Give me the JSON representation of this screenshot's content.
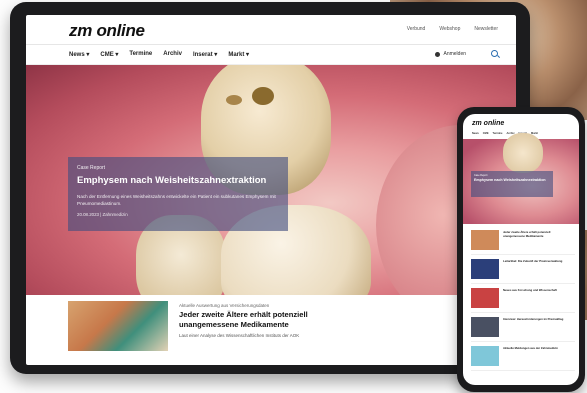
{
  "site": {
    "logo": "zm online",
    "top_links": [
      "Verbund",
      "Webshop",
      "Newsletter"
    ],
    "nav": [
      "News ▾",
      "CME ▾",
      "Termine",
      "Archiv",
      "Inserat ▾",
      "Markt ▾"
    ],
    "login": "Anmelden",
    "search_icon": "search-icon"
  },
  "hero": {
    "kicker": "Case Report",
    "headline": "Emphysem nach Weisheitszahnextraktion",
    "teaser": "Nach der Entfernung eines Weisheitszahns entwickelte ein Patient ein subkutanes Emphysem mit Pneumomediastinum.",
    "meta": "20.08.2023 | Zahnmedizin"
  },
  "story": {
    "kicker": "Aktuelle Auswertung aus Versicherungsdaten",
    "headline": "Jeder zweite Ältere erhält potenziell unangemessene Medikamente",
    "teaser": "Laut einer Analyse des Wissenschaftlichen Instituts der AOK"
  },
  "phone": {
    "logo": "zm online",
    "nav": [
      "News",
      "CME",
      "Termine",
      "Archiv",
      "Inserat",
      "Markt"
    ],
    "hero_kicker": "Case Report",
    "hero_headline": "Emphysem nach Weisheitszahnextraktion",
    "items": [
      {
        "title": "Jeder zweite Ältere erhält potenziell unangemessene Medikamente",
        "color": "#cf8a5a"
      },
      {
        "title": "Leitartikel: Die Zukunft der Praxisverwaltung",
        "color": "#2b3f7a"
      },
      {
        "title": "Neues aus Forschung und Wissenschaft",
        "color": "#c94242"
      },
      {
        "title": "Interview: Herausforderungen im Praxisalltag",
        "color": "#495062"
      },
      {
        "title": "Aktuelle Meldungen aus der Zahnmedizin",
        "color": "#7fc7d9"
      }
    ]
  },
  "colors": {
    "overlay": "#424e80",
    "accent": "#2a6db0"
  }
}
